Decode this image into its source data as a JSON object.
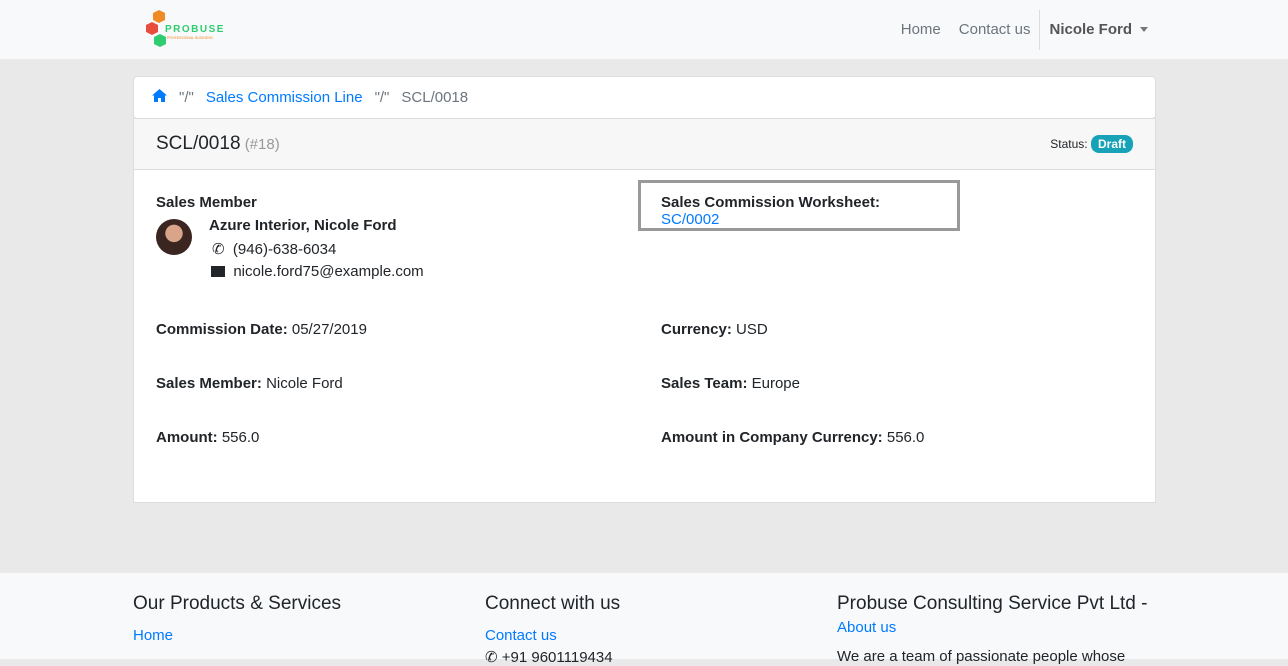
{
  "nav": {
    "brand": "PROBUSE",
    "brand_tagline": "PROFESSIONAL BUSINESS",
    "links": [
      "Home",
      "Contact us"
    ],
    "user": "Nicole Ford"
  },
  "breadcrumb": {
    "sep": "\"/\"",
    "parent": "Sales Commission Line",
    "current": "SCL/0018"
  },
  "record": {
    "title": "SCL/0018",
    "id": "(#18)",
    "status_label": "Status:",
    "status": "Draft",
    "member_heading": "Sales Member",
    "member_name": "Azure Interior, Nicole Ford",
    "phone": "(946)-638-6034",
    "email": "nicole.ford75@example.com",
    "worksheet_label": "Sales Commission Worksheet:",
    "worksheet": "SC/0002",
    "fields": [
      {
        "label": "Commission Date:",
        "value": "05/27/2019"
      },
      {
        "label": "Currency:",
        "value": "USD"
      },
      {
        "label": "Sales Member:",
        "value": "Nicole Ford"
      },
      {
        "label": "Sales Team:",
        "value": "Europe"
      },
      {
        "label": "Amount:",
        "value": "556.0"
      },
      {
        "label": "Amount in Company Currency:",
        "value": "556.0"
      }
    ]
  },
  "footer": {
    "col1": {
      "title": "Our Products & Services",
      "link": "Home"
    },
    "col2": {
      "title": "Connect with us",
      "link": "Contact us",
      "phone": "+91 9601119434"
    },
    "col3": {
      "title": "Probuse Consulting Service Pvt Ltd",
      "dash": "-",
      "link": "About us",
      "text": "We are a team of passionate people whose"
    }
  }
}
